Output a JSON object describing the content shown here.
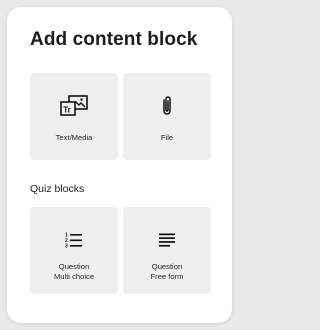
{
  "dialog": {
    "title": "Add content block",
    "tiles": [
      {
        "label": "Text/Media",
        "icon": "text-media-icon"
      },
      {
        "label": "File",
        "icon": "paperclip-icon"
      }
    ],
    "quiz_section_label": "Quiz blocks",
    "quiz_tiles": [
      {
        "label_line1": "Question",
        "label_line2": "Multi choice",
        "icon": "numbered-list-icon"
      },
      {
        "label_line1": "Question",
        "label_line2": "Free form",
        "icon": "text-lines-icon"
      }
    ]
  }
}
